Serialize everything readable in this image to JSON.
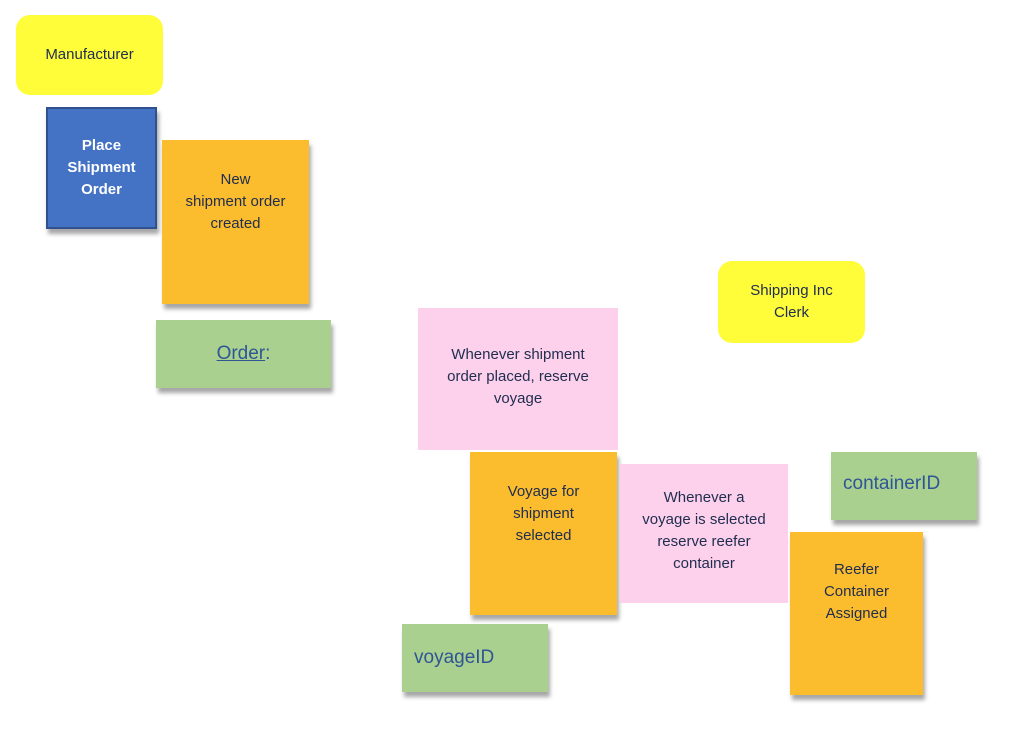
{
  "notes": {
    "manufacturer": "Manufacturer",
    "place_shipment_order": "Place\nShipment\nOrder",
    "new_shipment_order_created": "New\nshipment order\ncreated",
    "order_label": "Order",
    "order_suffix": ":",
    "shipping_inc_clerk": "Shipping Inc\nClerk",
    "policy_reserve_voyage": "Whenever shipment\norder placed, reserve\nvoyage",
    "voyage_selected": "Voyage for\nshipment\nselected",
    "policy_reserve_container": "Whenever a\nvoyage is selected\nreserve reefer\ncontainer",
    "container_id": "containerID",
    "reefer_assigned": "Reefer\nContainer\nAssigned",
    "voyage_id": "voyageID"
  },
  "colors": {
    "actor": "#fffd3a",
    "command": "#4472c4",
    "event": "#fbbc2d",
    "policy": "#fdd0ec",
    "data": "#a9d08e"
  }
}
